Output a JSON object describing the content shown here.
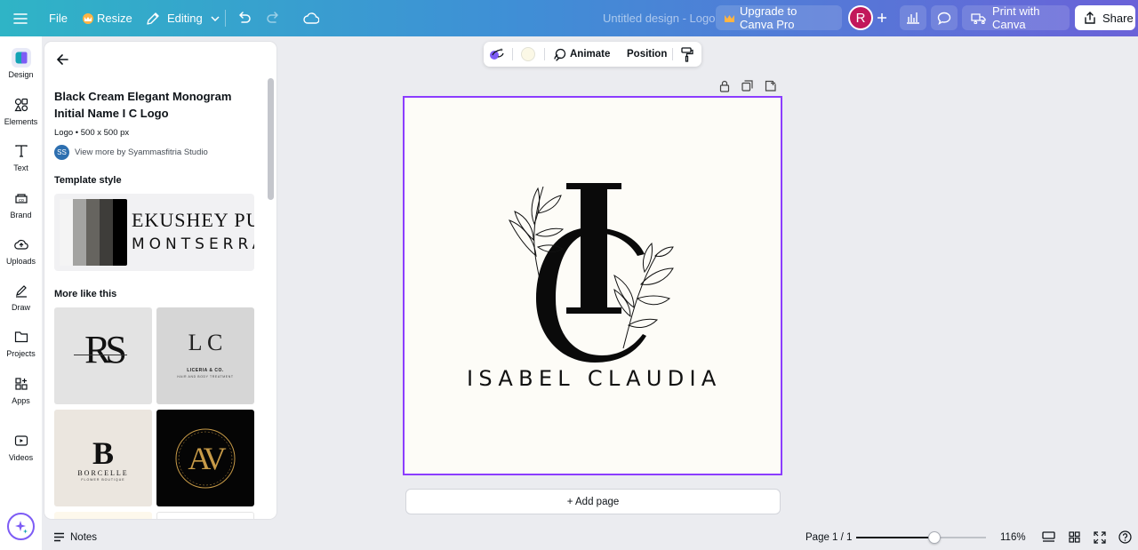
{
  "topbar": {
    "file_label": "File",
    "resize_label": "Resize",
    "editing_label": "Editing",
    "doc_title": "Untitled design - Logo",
    "upgrade_label": "Upgrade to Canva Pro",
    "avatar_initial": "R",
    "print_label": "Print with Canva",
    "share_label": "Share"
  },
  "rail": {
    "items": [
      {
        "label": "Design",
        "icon": "design-icon"
      },
      {
        "label": "Elements",
        "icon": "elements-icon"
      },
      {
        "label": "Text",
        "icon": "text-icon"
      },
      {
        "label": "Brand",
        "icon": "brand-icon"
      },
      {
        "label": "Uploads",
        "icon": "uploads-icon"
      },
      {
        "label": "Draw",
        "icon": "draw-icon"
      },
      {
        "label": "Projects",
        "icon": "projects-icon"
      },
      {
        "label": "Apps",
        "icon": "apps-icon"
      },
      {
        "label": "Videos",
        "icon": "videos-icon"
      }
    ]
  },
  "panel": {
    "title": "Black Cream Elegant Monogram Initial Name I C Logo",
    "meta_type": "Logo",
    "meta_size": "500 x 500 px",
    "author_initials": "SS",
    "author_link": "View more by Syammasfitria Studio",
    "template_style_heading": "Template style",
    "font_primary": "EKUSHEY PUN",
    "font_secondary": "MONTSERRA",
    "palette": [
      "#f4f4f4",
      "#a3a3a1",
      "#66645f",
      "#3e3d3a",
      "#000000"
    ],
    "more_heading": "More like this",
    "thumbs": [
      {
        "initials": "RS",
        "caption": "",
        "bg": "#e3e3e3"
      },
      {
        "initials": "L C",
        "caption": "LICERIA & CO.",
        "caption2": "HAIR AND BODY TREATMENT",
        "bg": "#d6d6d6"
      },
      {
        "initials": "B",
        "caption": "BORCELLE",
        "caption2": "FLOWER BOUTIQUE",
        "bg": "#ebe6df"
      },
      {
        "initials": "AV",
        "caption": "",
        "bg": "#050505"
      }
    ]
  },
  "floating_toolbar": {
    "animate_label": "Animate",
    "position_label": "Position",
    "color_swatch": "#fbf8e6"
  },
  "canvas": {
    "logo_letters": "IC",
    "logo_name": "ISABEL CLAUDIA",
    "background": "#fdfcf7",
    "add_page_label": "+ Add page"
  },
  "bottombar": {
    "notes_label": "Notes",
    "page_indicator": "Page 1 / 1",
    "zoom_label": "116%",
    "zoom_fraction": 0.6
  },
  "colors": {
    "accent": "#8b3dff",
    "crown": "#ffb443"
  }
}
